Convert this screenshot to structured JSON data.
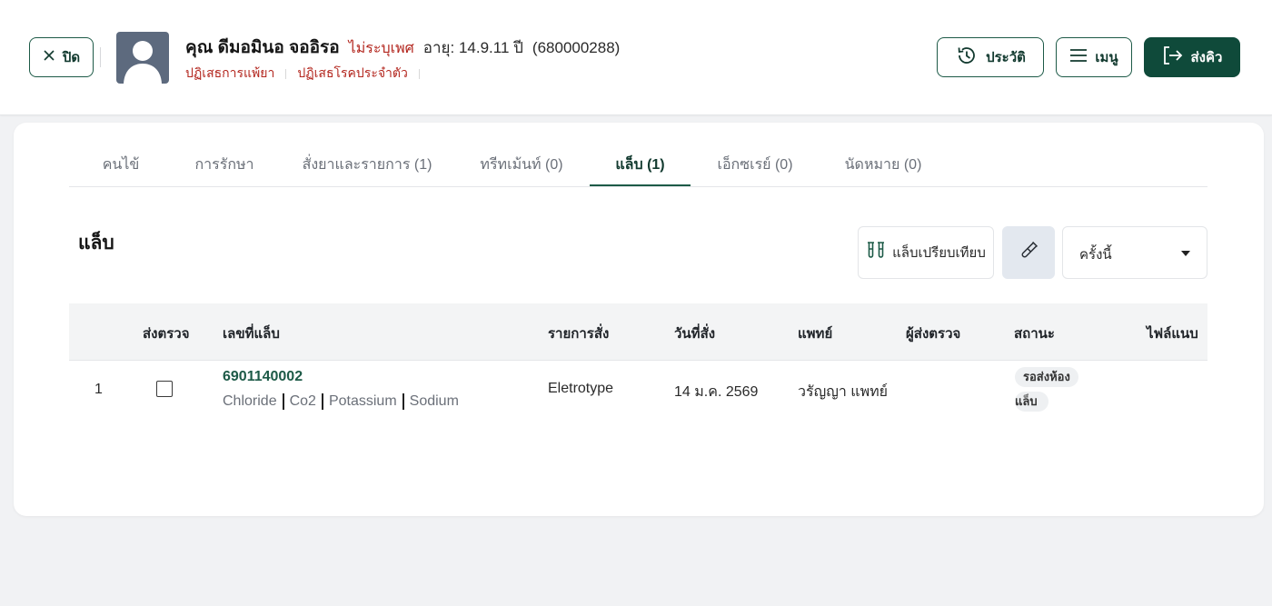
{
  "header": {
    "close_label": "ปิด",
    "patient_name": "คุณ ดีมอมินอ จออิรอ",
    "gender": "ไม่ระบุเพศ",
    "age": "อายุ: 14.9.11 ปี",
    "hn": "(680000288)",
    "allergy": "ปฏิเสธการแพ้ยา",
    "chronic": "ปฏิเสธโรคประจำตัว",
    "history_label": "ประวัติ",
    "menu_label": "เมนู",
    "send_queue_label": "ส่งคิว"
  },
  "tabs": [
    {
      "label": "คนไข้",
      "active": false
    },
    {
      "label": "การรักษา",
      "active": false
    },
    {
      "label": "สั่งยาและรายการ (1)",
      "active": false
    },
    {
      "label": "ทรีทเม้นท์ (0)",
      "active": false
    },
    {
      "label": "แล็บ (1)",
      "active": true
    },
    {
      "label": "เอ็กซเรย์ (0)",
      "active": false
    },
    {
      "label": "นัดหมาย (0)",
      "active": false
    }
  ],
  "lab": {
    "title": "แล็บ",
    "compare_label": "แล็บเปรียบเทียบ",
    "filter_value": "ครั้งนี้",
    "columns": [
      "ส่งตรวจ",
      "เลขที่แล็บ",
      "รายการสั่ง",
      "วันที่สั่ง",
      "แพทย์",
      "ผู้ส่งตรวจ",
      "สถานะ",
      "ไฟล์แนบ"
    ],
    "rows": [
      {
        "index": "1",
        "checked": false,
        "lab_no": "6901140002",
        "tests": [
          "Chloride",
          "Co2",
          "Potassium",
          "Sodium"
        ],
        "order": "Eletrotype",
        "date": "14 ม.ค. 2569",
        "doctor": "วรัญญา แพทย์",
        "sender": "",
        "status_line1": "รอส่งห้อง",
        "status_line2": "แล็บ",
        "attachment": ""
      }
    ]
  },
  "colors": {
    "primary": "#0f4a3a",
    "primary_border": "#1d5a47",
    "danger_text": "#b3261e",
    "page_bg": "#f1f2f4"
  }
}
